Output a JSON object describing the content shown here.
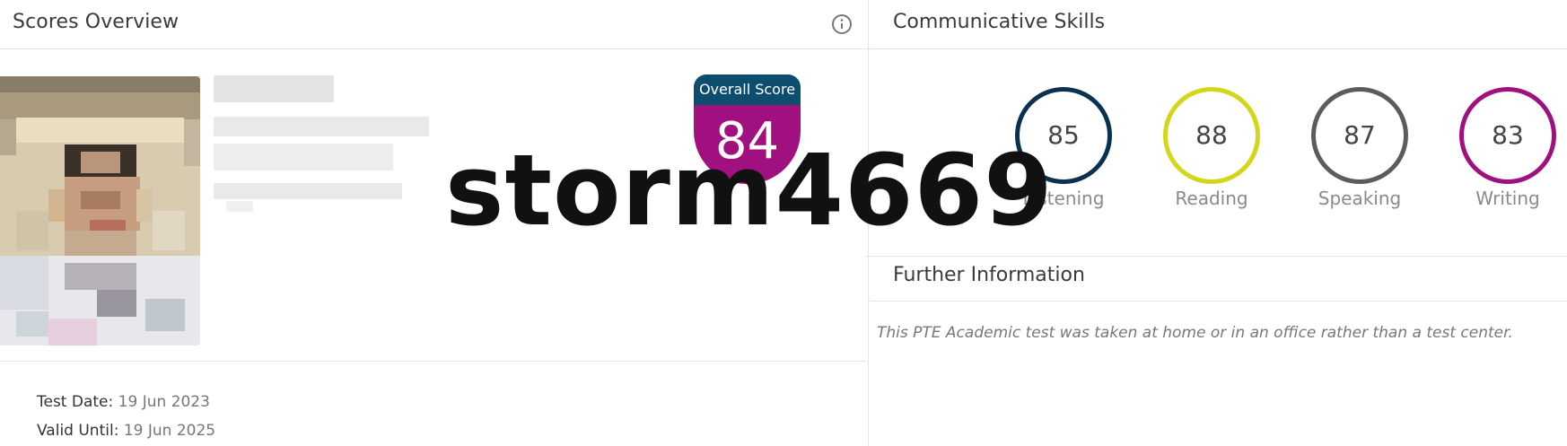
{
  "scores_overview": {
    "title": "Scores Overview",
    "info_icon": "info-icon",
    "overall_score": {
      "label": "Overall Score",
      "value": "84"
    },
    "test_date": {
      "label": "Test Date",
      "value": "19 Jun 2023"
    },
    "valid_until": {
      "label": "Valid Until",
      "value": "19 Jun 2025"
    }
  },
  "communicative_skills": {
    "title": "Communicative Skills",
    "skills": [
      {
        "name": "Listening",
        "score": "85",
        "color": "#0b3150"
      },
      {
        "name": "Reading",
        "score": "88",
        "color": "#d3d61a"
      },
      {
        "name": "Speaking",
        "score": "87",
        "color": "#5c5c5c"
      },
      {
        "name": "Writing",
        "score": "83",
        "color": "#a1107f"
      }
    ]
  },
  "further_information": {
    "title": "Further Information",
    "note": "This PTE Academic test was taken at home or in an office rather than a test center."
  },
  "watermark": {
    "text": "storm4669"
  },
  "colors": {
    "badge_header": "#0d4d6e",
    "badge_body": "#a1107f"
  }
}
